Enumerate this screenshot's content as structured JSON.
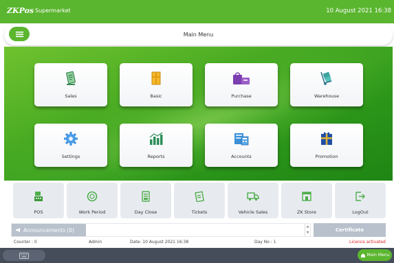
{
  "topbar": {
    "brand": "ZKPos",
    "store_name": "Supermarket",
    "datetime": "10 August 2021 16:38"
  },
  "header": {
    "title": "Main Menu",
    "menu_icon": "hamburger-icon"
  },
  "main_tiles": [
    {
      "label": "Sales",
      "icon": "sales-receipt-icon"
    },
    {
      "label": "Basic",
      "icon": "basic-box-icon"
    },
    {
      "label": "Purchase",
      "icon": "purchase-bag-icon"
    },
    {
      "label": "Warehouse",
      "icon": "warehouse-trolley-icon"
    },
    {
      "label": "Settings",
      "icon": "gear-icon"
    },
    {
      "label": "Reports",
      "icon": "reports-chart-icon"
    },
    {
      "label": "Accounts",
      "icon": "accounts-icon"
    },
    {
      "label": "Promotion",
      "icon": "promotion-gift-icon"
    }
  ],
  "bottom_tiles": [
    {
      "label": "POS",
      "icon": "pos-terminal-icon"
    },
    {
      "label": "Work Period",
      "icon": "work-period-icon"
    },
    {
      "label": "Day Close",
      "icon": "day-close-icon"
    },
    {
      "label": "Tickets",
      "icon": "tickets-icon"
    },
    {
      "label": "Vehicle Sales",
      "icon": "truck-icon"
    },
    {
      "label": "ZK Store",
      "icon": "store-icon"
    },
    {
      "label": "LogOut",
      "icon": "logout-icon"
    }
  ],
  "announcements": {
    "label": "Announcements (0)",
    "icon": "megaphone-icon"
  },
  "certificate_button": "Certificate",
  "status": {
    "counter": "Counter : 0",
    "user": "Admin",
    "date": "Date: 10 August 2021 16:38",
    "day_no": "Day No : 1",
    "licence": "Licence activated"
  },
  "footer": {
    "keyboard_icon": "keyboard-icon",
    "home_label": "Main Menu",
    "home_icon": "home-icon"
  },
  "colors": {
    "brand_green": "#5ab52f",
    "footer_dark": "#454c5a",
    "licence_red": "#e02020"
  }
}
